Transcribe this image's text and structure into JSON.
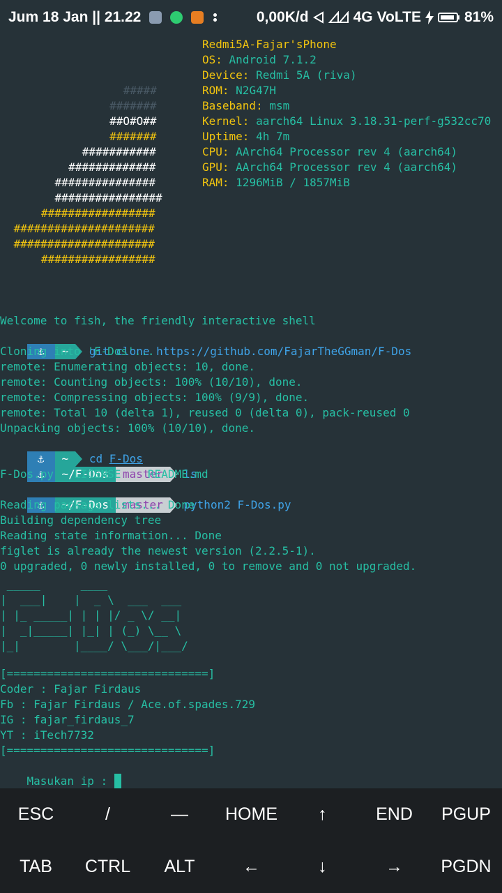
{
  "status_bar": {
    "datetime": "Jum 18 Jan || 21.22",
    "net_speed": "0,00K/d",
    "network": "4G",
    "volte": "VoLTE",
    "battery": "81%"
  },
  "sysinfo": {
    "hostname": "Redmi5A-Fajar'sPhone",
    "rows": [
      {
        "label": "OS:",
        "value": "Android 7.1.2"
      },
      {
        "label": "Device:",
        "value": "Redmi 5A (riva)"
      },
      {
        "label": "ROM:",
        "value": "N2G47H"
      },
      {
        "label": "Baseband:",
        "value": "msm"
      },
      {
        "label": "Kernel:",
        "value": "aarch64 Linux 3.18.31-perf-g532cc70"
      },
      {
        "label": "Uptime:",
        "value": "4h 7m"
      },
      {
        "label": "CPU:",
        "value": "AArch64 Processor rev 4 (aarch64)"
      },
      {
        "label": "GPU:",
        "value": "AArch64 Processor rev 4 (aarch64)"
      },
      {
        "label": "RAM:",
        "value": "1296MiB / 1857MiB"
      }
    ]
  },
  "logo_lines": [
    "         #####",
    "        #######",
    "        ##O#O##",
    "        #######",
    "      ###########",
    "     #############",
    "    ###############",
    "    ################",
    "   #################",
    " #####################",
    " #####################",
    "   #################"
  ],
  "terminal": {
    "welcome": "Welcome to fish, the friendly interactive shell",
    "prompt_anchor": "⚓",
    "home_dir": "~",
    "project_dir": "~/F-Dos",
    "branch": "master",
    "cmd1_a": "git",
    "cmd1_b": "clone",
    "cmd1_c": "https://github.com/FajarTheGGman/F-Dos",
    "clone_lines": [
      "Cloning into 'F-Dos'...",
      "remote: Enumerating objects: 10, done.",
      "remote: Counting objects: 100% (10/10), done.",
      "remote: Compressing objects: 100% (9/9), done.",
      "remote: Total 10 (delta 1), reused 0 (delta 0), pack-reused 0",
      "Unpacking objects: 100% (10/10), done."
    ],
    "cmd2_a": "cd",
    "cmd2_b": "F-Dos",
    "cmd3": "ls",
    "ls_output": "F-Dos.py   LICENSE    README.md",
    "cmd4_a": "python2",
    "cmd4_b": "F-Dos.py",
    "apt_lines": [
      "Reading package lists... Done",
      "Building dependency tree",
      "Reading state information... Done",
      "figlet is already the newest version (2.2.5-1).",
      "0 upgraded, 0 newly installed, 0 to remove and 0 not upgraded."
    ],
    "figlet_lines": [
      " _____      ____",
      "|  ___|    |  _ \\  ___  ___",
      "| |_ _____| | | |/ _ \\/ __|",
      "|  _|_____| |_| | (_) \\__ \\",
      "|_|        |____/ \\___/|___/"
    ],
    "separator": "[==============================]",
    "credits": [
      "Coder : Fajar Firdaus",
      "Fb : Fajar Firdaus / Ace.of.spades.729",
      "IG : fajar_firdaus_7",
      "YT : iTech7732"
    ],
    "input_prompt": "Masukan ip : "
  },
  "extra_keys": {
    "row1": [
      "ESC",
      "/",
      "—",
      "HOME",
      "↑",
      "END",
      "PGUP"
    ],
    "row2": [
      "TAB",
      "CTRL",
      "ALT",
      "←",
      "↓",
      "→",
      "PGDN"
    ]
  },
  "colors": {
    "background": "#263238",
    "text_green": "#26bfa4",
    "label_yellow": "#f1c40f",
    "command_blue": "#3fa4e9",
    "prompt_anchor_bg": "#2e7fb5",
    "prompt_dir_bg": "#26a69a",
    "prompt_branch_bg": "#c9cfd3",
    "branch_text": "#8e44ad",
    "keyboard_bg": "#1c1f22"
  }
}
